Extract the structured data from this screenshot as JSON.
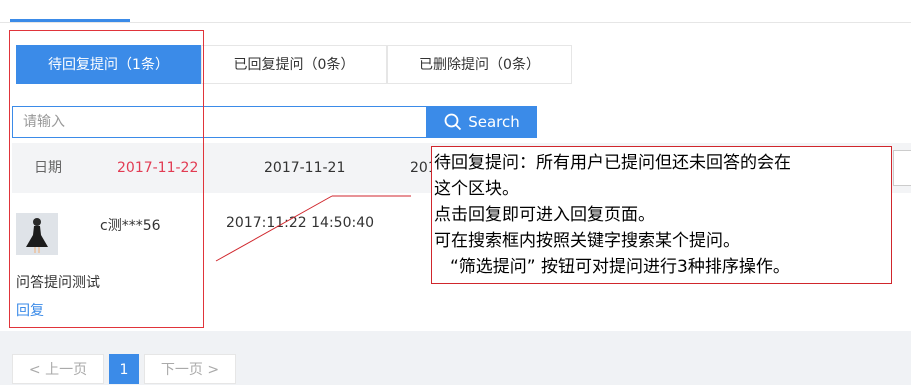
{
  "tabs": [
    {
      "label": "待回复提问（1条）"
    },
    {
      "label": "已回复提问（0条）"
    },
    {
      "label": "已删除提问（0条）"
    }
  ],
  "search": {
    "placeholder": "请输入",
    "button_label": "Search"
  },
  "date_filter": {
    "label": "日期",
    "dates": [
      "2017-11-22",
      "2017-11-21",
      "201"
    ]
  },
  "question_item": {
    "username": "c测***56",
    "timestamp": "2017:11:22 14:50:40",
    "text": "问答提问测试",
    "reply_label": "回复"
  },
  "annotation": {
    "lines": [
      "待回复提问：所有用户已提问但还未回答的会在",
      "这个区块。",
      "点击回复即可进入回复页面。",
      "可在搜索框内按照关键字搜索某个提问。",
      "“筛选提问” 按钮可对提问进行3种排序操作。"
    ]
  },
  "pagination": {
    "prev_label": "< 上一页",
    "current": "1",
    "next_label": "下一页 >"
  },
  "colors": {
    "accent": "#3b8be8",
    "highlight_date": "#e23b53",
    "annotation_border": "#d0262c"
  }
}
